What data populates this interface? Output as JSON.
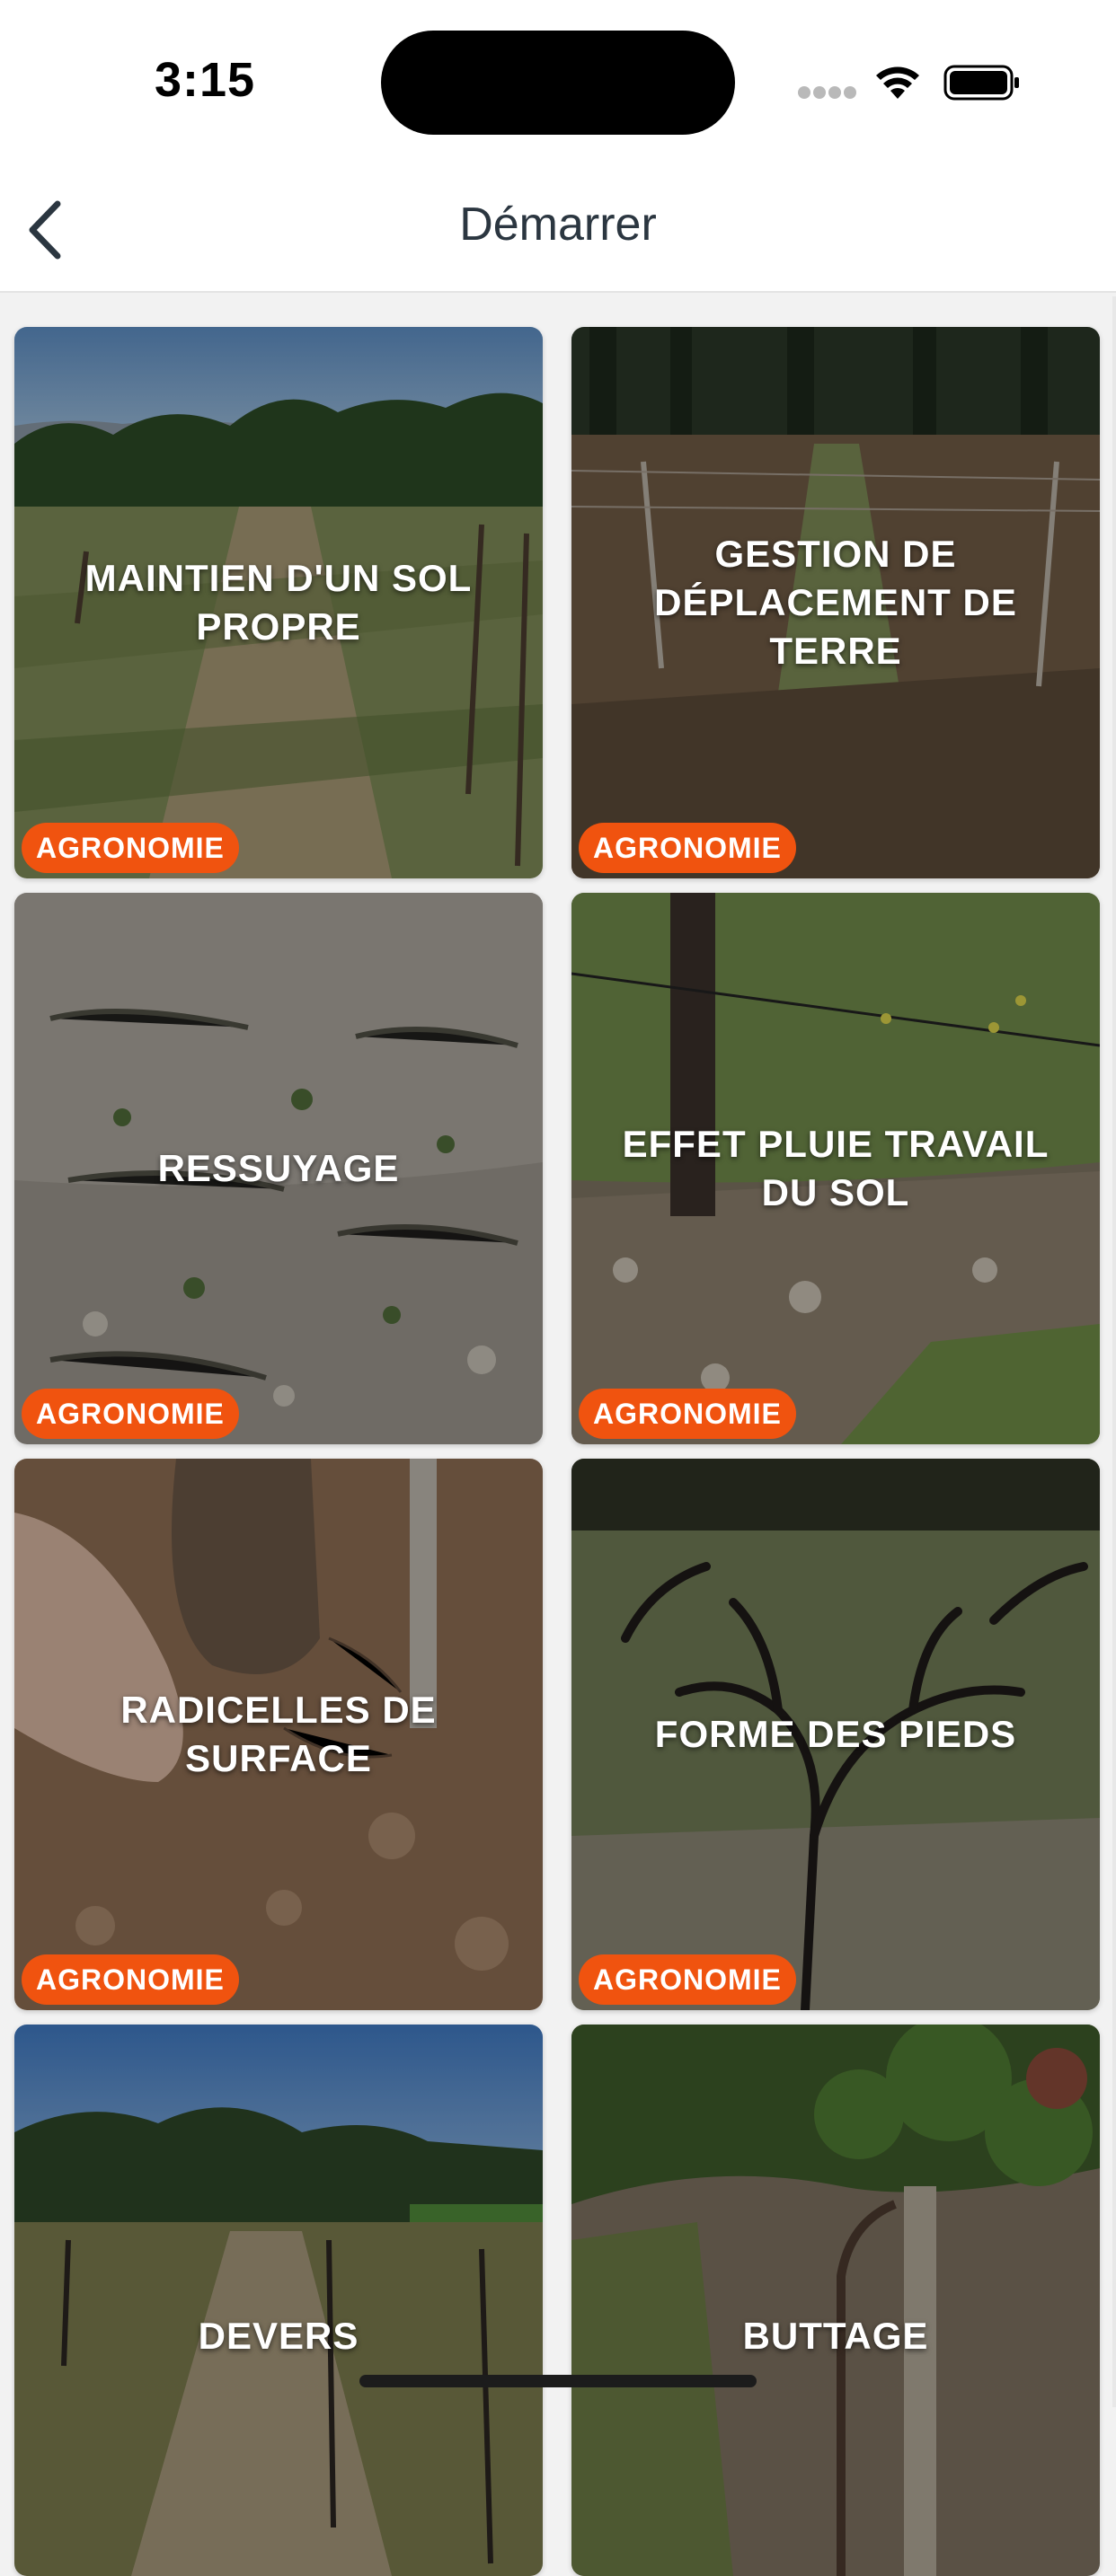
{
  "status_bar": {
    "time": "3:15",
    "icons": [
      "cellular-signal-icon",
      "wifi-icon",
      "battery-icon"
    ]
  },
  "nav": {
    "title": "Démarrer",
    "back_icon": "chevron-left-icon"
  },
  "colors": {
    "badge": "#f0530f",
    "title_text": "#2b3640",
    "background": "#f2f2f2"
  },
  "cards": [
    {
      "title": "MAINTIEN D'UN SOL PROPRE",
      "badge": "AGRONOMIE"
    },
    {
      "title": "GESTION DE DÉPLACEMENT DE TERRE",
      "badge": "AGRONOMIE"
    },
    {
      "title": "RESSUYAGE",
      "badge": "AGRONOMIE"
    },
    {
      "title": "EFFET PLUIE TRAVAIL DU SOL",
      "badge": "AGRONOMIE"
    },
    {
      "title": "RADICELLES DE SURFACE",
      "badge": "AGRONOMIE"
    },
    {
      "title": "FORME DES PIEDS",
      "badge": "AGRONOMIE"
    },
    {
      "title": "DEVERS",
      "badge": ""
    },
    {
      "title": "BUTTAGE",
      "badge": ""
    }
  ]
}
